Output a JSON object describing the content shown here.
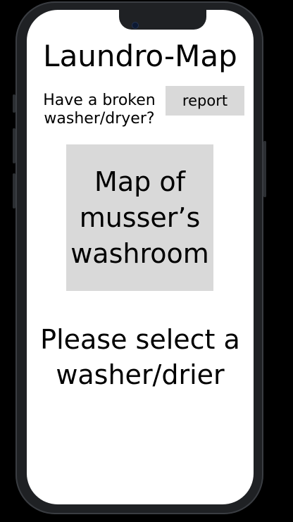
{
  "app": {
    "title": "Laundro-Map"
  },
  "report": {
    "prompt": "Have a broken\nwasher/dryer?",
    "button_label": "report"
  },
  "map": {
    "label": "Map of\nmusser’s\nwashroom"
  },
  "selection": {
    "prompt": "Please select a\nwasher/drier"
  },
  "colors": {
    "background": "#000000",
    "screen": "#ffffff",
    "placeholder_gray": "#d9d9d9",
    "frame": "#1f2124"
  }
}
